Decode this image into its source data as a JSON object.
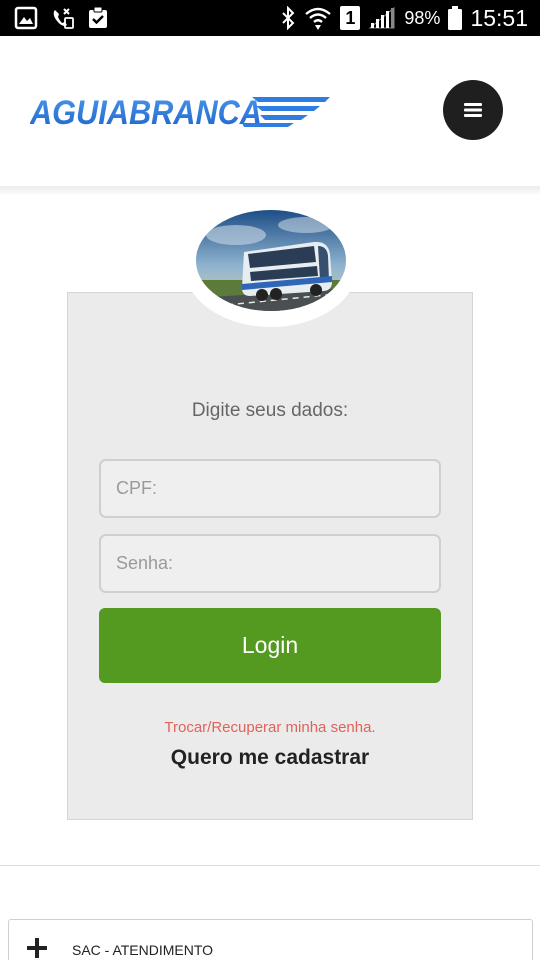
{
  "status_bar": {
    "battery": "98%",
    "time": "15:51",
    "sim": "1"
  },
  "header": {
    "brand": "AGUIABRANCA",
    "brand_color": "#2f7de1",
    "menu_icon": "hamburger-icon"
  },
  "login": {
    "prompt": "Digite seus dados:",
    "cpf_placeholder": "CPF:",
    "password_placeholder": "Senha:",
    "login_label": "Login",
    "recover_link": "Trocar/Recuperar minha senha.",
    "register_link": "Quero me cadastrar",
    "button_color": "#559a20",
    "link_color": "#e0635a"
  },
  "footer": {
    "sac_label": "SAC - ATENDIMENTO",
    "sac_icon": "plus-icon"
  }
}
